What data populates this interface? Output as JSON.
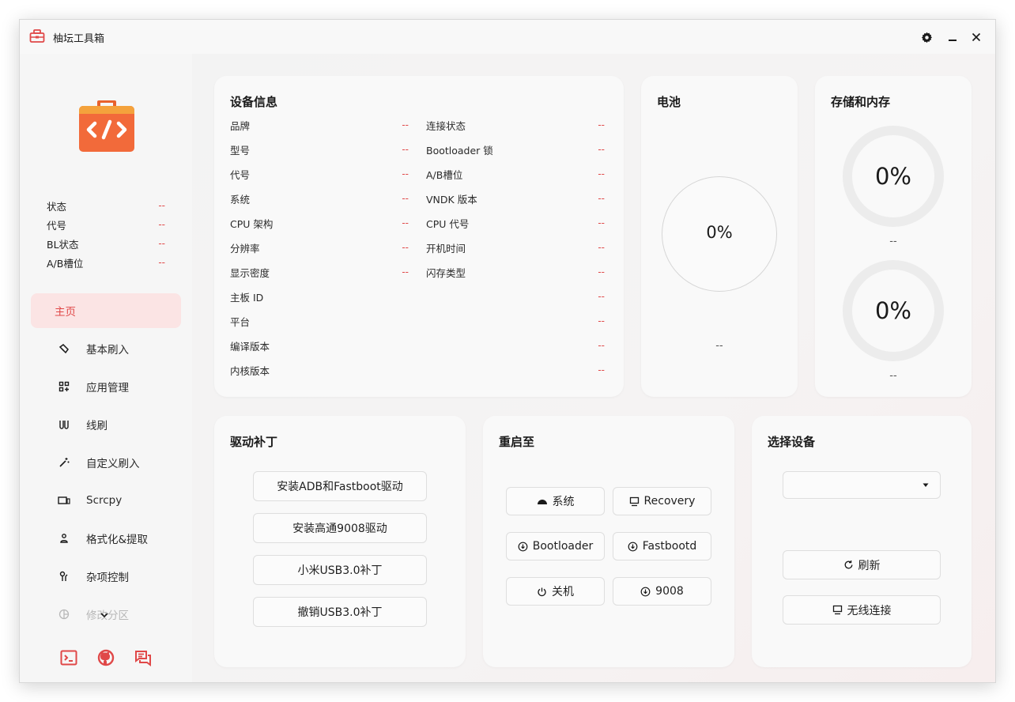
{
  "window": {
    "title": "柚坛工具箱"
  },
  "colors": {
    "accent": "#e04848",
    "active_bg": "#fbe4e4",
    "logo_orange": "#f26a3a"
  },
  "sidebar": {
    "status": [
      {
        "label": "状态",
        "value": "--"
      },
      {
        "label": "代号",
        "value": "--"
      },
      {
        "label": "BL状态",
        "value": "--"
      },
      {
        "label": "A/B槽位",
        "value": "--"
      }
    ],
    "nav": [
      {
        "label": "主页",
        "icon": "home",
        "active": true
      },
      {
        "label": "基本刷入",
        "icon": "flash-icon"
      },
      {
        "label": "应用管理",
        "icon": "apps-icon"
      },
      {
        "label": "线刷",
        "icon": "cable-flash-icon"
      },
      {
        "label": "自定义刷入",
        "icon": "magic-wand-icon"
      },
      {
        "label": "Scrcpy",
        "icon": "screen-mirror-icon"
      },
      {
        "label": "格式化&提取",
        "icon": "format-icon"
      },
      {
        "label": "杂项控制",
        "icon": "tools-icon"
      },
      {
        "label": "修改分区",
        "icon": "partition-icon"
      }
    ]
  },
  "device_info": {
    "title": "设备信息",
    "left": [
      {
        "label": "品牌",
        "value": "--"
      },
      {
        "label": "型号",
        "value": "--"
      },
      {
        "label": "代号",
        "value": "--"
      },
      {
        "label": "系统",
        "value": "--"
      },
      {
        "label": "CPU 架构",
        "value": "--"
      },
      {
        "label": "分辨率",
        "value": "--"
      },
      {
        "label": "显示密度",
        "value": "--"
      }
    ],
    "right": [
      {
        "label": "连接状态",
        "value": "--"
      },
      {
        "label": "Bootloader 锁",
        "value": "--"
      },
      {
        "label": "A/B槽位",
        "value": "--"
      },
      {
        "label": "VNDK 版本",
        "value": "--"
      },
      {
        "label": "CPU 代号",
        "value": "--"
      },
      {
        "label": "开机时间",
        "value": "--"
      },
      {
        "label": "闪存类型",
        "value": "--"
      }
    ],
    "full": [
      {
        "label": "主板 ID",
        "value": "--"
      },
      {
        "label": "平台",
        "value": "--"
      },
      {
        "label": "编译版本",
        "value": "--"
      },
      {
        "label": "内核版本",
        "value": "--"
      }
    ]
  },
  "battery": {
    "title": "电池",
    "percent": "0%",
    "detail": "--"
  },
  "storage": {
    "title": "存储和内存",
    "storage_percent": "0%",
    "storage_detail": "--",
    "memory_percent": "0%",
    "memory_detail": "--"
  },
  "drivers": {
    "title": "驱动补丁",
    "buttons": [
      "安装ADB和Fastboot驱动",
      "安装高通9008驱动",
      "小米USB3.0补丁",
      "撤销USB3.0补丁"
    ]
  },
  "reboot": {
    "title": "重启至",
    "buttons": [
      {
        "label": "系统",
        "icon": "android-icon"
      },
      {
        "label": "Recovery",
        "icon": "monitor-icon"
      },
      {
        "label": "Bootloader",
        "icon": "reboot-arrow-icon"
      },
      {
        "label": "Fastbootd",
        "icon": "reboot-arrow-icon"
      },
      {
        "label": "关机",
        "icon": "power-icon"
      },
      {
        "label": "9008",
        "icon": "reboot-arrow-icon"
      }
    ]
  },
  "select_device": {
    "title": "选择设备",
    "selected": "",
    "refresh": "刷新",
    "wireless": "无线连接"
  }
}
